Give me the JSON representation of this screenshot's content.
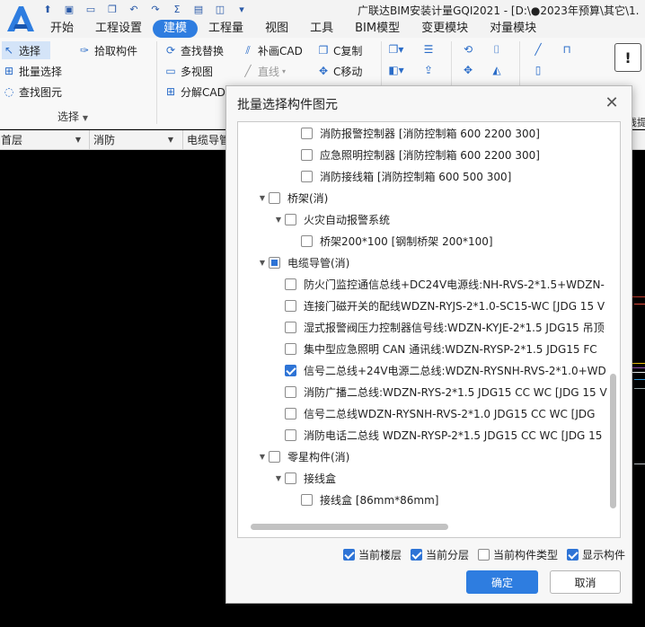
{
  "app": {
    "title": "广联达BIM安装计量GQI2021 - [D:\\●2023年预算\\其它\\1.",
    "logo_letter": "A",
    "qa_icons": [
      "save-icon",
      "open-icon",
      "folder-icon",
      "copy-icon",
      "undo-icon",
      "redo-icon",
      "sum-icon",
      "doc-icon",
      "ruler-icon",
      "more-icon"
    ],
    "qa_glyphs": [
      "⬆",
      "▣",
      "▭",
      "❐",
      "↶",
      "↷",
      "Σ",
      "▤",
      "◫",
      "▾"
    ]
  },
  "menu_tabs": [
    {
      "label": "开始",
      "active": false
    },
    {
      "label": "工程设置",
      "active": false
    },
    {
      "label": "建模",
      "active": true
    },
    {
      "label": "工程量",
      "active": false
    },
    {
      "label": "视图",
      "active": false
    },
    {
      "label": "工具",
      "active": false
    },
    {
      "label": "BIM模型",
      "active": false
    },
    {
      "label": "变更模块",
      "active": false
    },
    {
      "label": "对量模块",
      "active": false
    }
  ],
  "ribbon": {
    "select": "选择",
    "batch_select": "批量选择",
    "find_element": "查找图元",
    "pick_component": "拾取构件",
    "group_label": "选择",
    "find_replace": "查找替换",
    "multi_view": "多视图",
    "decompose_cad": "分解CAD",
    "supplement_cad": "补画CAD",
    "line": "直线",
    "c_copy": "C复制",
    "c_move": "C移动",
    "alarm_label": "报警管线提"
  },
  "dropdowns": {
    "floor": "首层",
    "discipline": "消防",
    "component_type": "电缆导管"
  },
  "dialog": {
    "title": "批量选择构件图元",
    "tree": [
      {
        "label": "消防报警控制器 [消防控制箱 600 2200 300]",
        "level": 2,
        "state": "unchecked",
        "expander": ""
      },
      {
        "label": "应急照明控制器 [消防控制箱 600 2200 300]",
        "level": 2,
        "state": "unchecked",
        "expander": ""
      },
      {
        "label": "消防接线箱 [消防控制箱 600 500 300]",
        "level": 2,
        "state": "unchecked",
        "expander": ""
      },
      {
        "label": "桥架(消)",
        "level": 0,
        "state": "unchecked",
        "expander": "▼"
      },
      {
        "label": "火灾自动报警系统",
        "level": 1,
        "state": "unchecked",
        "expander": "▼"
      },
      {
        "label": "桥架200*100 [钢制桥架 200*100]",
        "level": 2,
        "state": "unchecked",
        "expander": ""
      },
      {
        "label": "电缆导管(消)",
        "level": 0,
        "state": "partial",
        "expander": "▼"
      },
      {
        "label": "防火门监控通信总线+DC24V电源线:NH-RVS-2*1.5+WDZN-",
        "level": 1,
        "state": "unchecked",
        "expander": ""
      },
      {
        "label": "连接门磁开关的配线WDZN-RYJS-2*1.0-SC15-WC [JDG 15 V",
        "level": 1,
        "state": "unchecked",
        "expander": ""
      },
      {
        "label": "湿式报警阀压力控制器信号线:WDZN-KYJE-2*1.5 JDG15 吊顶",
        "level": 1,
        "state": "unchecked",
        "expander": ""
      },
      {
        "label": "集中型应急照明 CAN 通讯线:WDZN-RYSP-2*1.5 JDG15 FC",
        "level": 1,
        "state": "unchecked",
        "expander": ""
      },
      {
        "label": "信号二总线+24V电源二总线:WDZN-RYSNH-RVS-2*1.0+WD",
        "level": 1,
        "state": "checked",
        "expander": ""
      },
      {
        "label": "消防广播二总线:WDZN-RYS-2*1.5 JDG15 CC WC [JDG 15 V",
        "level": 1,
        "state": "unchecked",
        "expander": ""
      },
      {
        "label": "信号二总线WDZN-RYSNH-RVS-2*1.0 JDG15 CC WC [JDG",
        "level": 1,
        "state": "unchecked",
        "expander": ""
      },
      {
        "label": "消防电话二总线 WDZN-RYSP-2*1.5 JDG15 CC WC [JDG 15",
        "level": 1,
        "state": "unchecked",
        "expander": ""
      },
      {
        "label": "零星构件(消)",
        "level": 0,
        "state": "unchecked",
        "expander": "▼"
      },
      {
        "label": "接线盒",
        "level": 1,
        "state": "unchecked",
        "expander": "▼"
      },
      {
        "label": "接线盒 [86mm*86mm]",
        "level": 2,
        "state": "unchecked",
        "expander": ""
      }
    ],
    "options": [
      {
        "label": "当前楼层",
        "checked": true
      },
      {
        "label": "当前分层",
        "checked": true
      },
      {
        "label": "当前构件类型",
        "checked": false
      },
      {
        "label": "显示构件",
        "checked": true
      }
    ],
    "ok_label": "确定",
    "cancel_label": "取消",
    "close_glyph": "✕"
  },
  "colors": {
    "accent": "#2e7de0",
    "check": "#2e74d6",
    "canvas": "#000000"
  }
}
